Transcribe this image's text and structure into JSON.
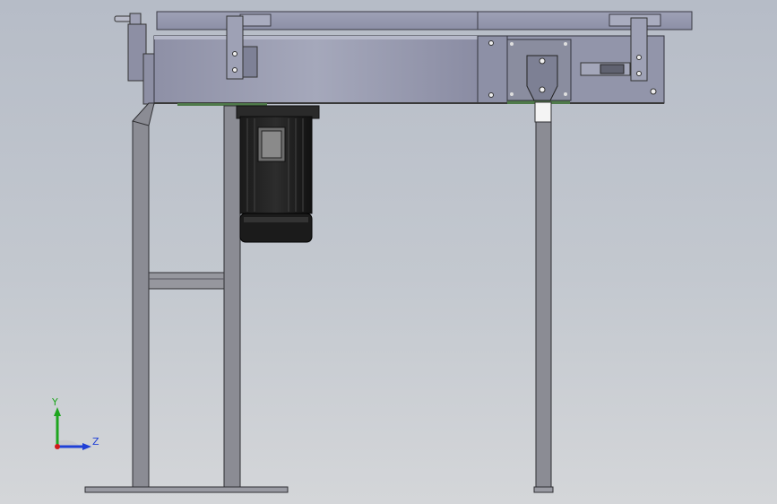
{
  "app": {
    "view": "front-orthographic",
    "background_top": "#b6bcc7",
    "background_bottom": "#d4d6d9"
  },
  "model": {
    "parts": [
      "conveyor-frame",
      "drive-motor",
      "support-legs",
      "cross-brace",
      "base-plate",
      "drive-end-plate",
      "tension-handle",
      "adjust-knob"
    ]
  },
  "triad": {
    "y_label": "Y",
    "z_label": "Z",
    "y_color": "#1ea51e",
    "z_color": "#1f3fd6",
    "x_color": "#d11a1a"
  }
}
